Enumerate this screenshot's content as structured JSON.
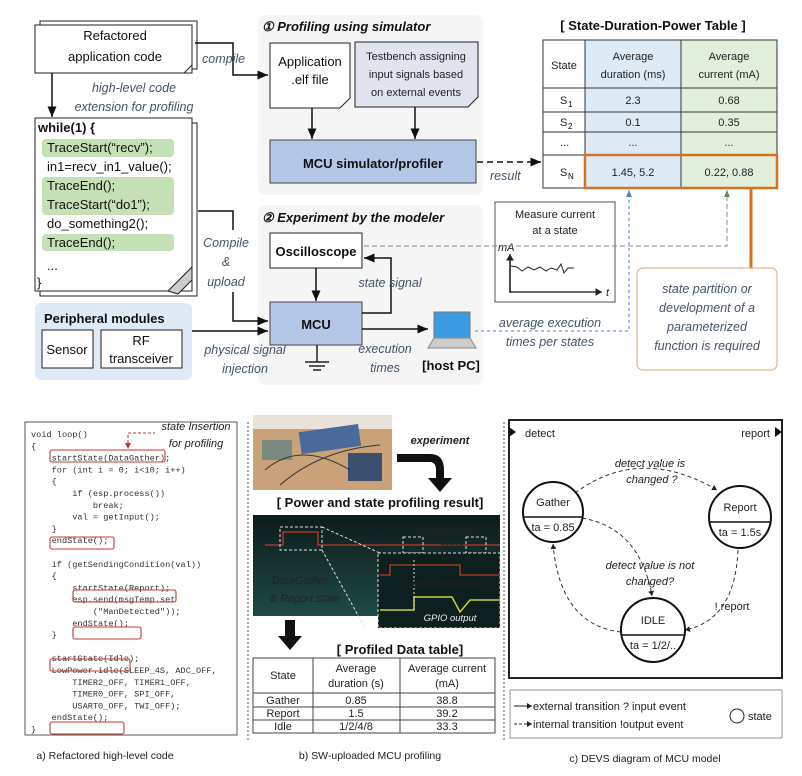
{
  "top": {
    "refactored_doc": [
      "Refactored",
      "application code"
    ],
    "compile_label": "compile",
    "extension_label": [
      "high-level code",
      "extension for profiling"
    ],
    "code_lines": [
      "while(1) {",
      "TraceStart(“recv”);",
      "in1=recv_in1_value();",
      "TraceEnd();",
      "TraceStart(“do1”);",
      "do_something2();",
      "TraceEnd();",
      "...",
      "}"
    ],
    "profiling": {
      "title": "① Profiling using simulator",
      "elf_file": [
        "Application",
        ".elf file"
      ],
      "testbench": [
        "Testbench assigning",
        "input signals based",
        "on external events"
      ],
      "simulator": "MCU simulator/profiler",
      "result_label": "result"
    },
    "experiment": {
      "title": "② Experiment by the modeler",
      "oscilloscope": "Oscilloscope",
      "mcu": "MCU",
      "state_signal": "state signal",
      "compile_upload": [
        "Compile",
        "&",
        "upload"
      ],
      "physical_signal": [
        "physical signal",
        "injection"
      ],
      "execution_times": [
        "execution",
        "times"
      ],
      "host_pc": "[host PC]"
    },
    "peripheral": {
      "title": "Peripheral modules",
      "sensor": "Sensor",
      "rf": [
        "RF",
        "transceiver"
      ]
    },
    "measure_box": {
      "title": [
        "Measure current",
        "at a state"
      ],
      "y_axis": "mA",
      "x_axis": "t"
    },
    "avg_exec_label": [
      "average execution",
      "times per states"
    ],
    "note": [
      "state partition or",
      "development of a",
      "parameterized",
      "function is required"
    ],
    "state_table": {
      "title": "[ State-Duration-Power Table ]",
      "headers": [
        "State",
        [
          "Average",
          "duration (ms)"
        ],
        [
          "Average",
          "current (mA)"
        ]
      ],
      "rows": [
        {
          "state": "S",
          "sub": "1",
          "duration": "2.3",
          "current": "0.68"
        },
        {
          "state": "S",
          "sub": "2",
          "duration": "0.1",
          "current": "0.35"
        },
        {
          "state": "...",
          "sub": "",
          "duration": "...",
          "current": "..."
        },
        {
          "state": "S",
          "sub": "N",
          "duration": "1.45, 5.2",
          "current": "0.22, 0.88"
        }
      ]
    }
  },
  "panel_a": {
    "annotation": [
      "state Insertion",
      "for profiling"
    ],
    "caption": "a) Refactored high-level code",
    "code": [
      "void loop()",
      "{",
      "    startState(DataGather);",
      "    for (int i = 0; i<10; i++)",
      "    {",
      "        if (esp.process())",
      "            break;",
      "        val = getInput();",
      "    }",
      "    endState();",
      "",
      "    if (getSendingCondition(val))",
      "    {",
      "        startState(Report);",
      "        esp.send(msgTemp.set",
      "            (\"ManDetected\"));",
      "        endState();",
      "    }",
      "",
      "    startState(Idle);",
      "    LowPower.idle(SLEEP_4S, ADC_OFF,",
      "        TIMER2_OFF, TIMER1_OFF,",
      "        TIMER0_OFF, SPI_OFF,",
      "        USART0_OFF, TWI_OFF);",
      "    endState();",
      "}"
    ]
  },
  "panel_b": {
    "experiment_label": "experiment",
    "scope_title": "[ Power and state profiling result]",
    "scope_labels": {
      "datagather_state": [
        "DataGather",
        "state"
      ],
      "datagather_report": [
        "DataGather",
        "& Report state"
      ],
      "state_separation": "State separation",
      "gpio_output": "GPIO output"
    },
    "table_title": "[ Profiled Data table]",
    "table": {
      "headers": [
        "State",
        [
          "Average",
          "duration (s)"
        ],
        [
          "Average current",
          "(mA)"
        ]
      ],
      "rows": [
        [
          "Gather",
          "0.85",
          "38.8"
        ],
        [
          "Report",
          "1.5",
          "39.2"
        ],
        [
          "Idle",
          "1/2/4/8",
          "33.3"
        ]
      ]
    },
    "caption": "b) SW-uploaded MCU profiling"
  },
  "panel_c": {
    "input_port": "detect",
    "output_port": "report",
    "states": [
      {
        "name": "Gather",
        "ta": "ta = 0.85"
      },
      {
        "name": "Report",
        "ta": "ta = 1.5s"
      },
      {
        "name": "IDLE",
        "ta": "ta = 1/2/.."
      }
    ],
    "transitions": {
      "changed": [
        "detect value is",
        "changed ?"
      ],
      "not_changed": [
        "detect value is not",
        "changed?"
      ],
      "report_out": "! report"
    },
    "legend": {
      "external": "external transition ? input event",
      "internal": "internal transition  !output event",
      "state": "state"
    },
    "caption": "c) DEVS diagram of MCU model"
  },
  "colors": {
    "sim_blue": "#b4c7e7",
    "code_green": "#c5e0b4",
    "orange": "#d6711f",
    "duration_col": "#ddebf7",
    "current_col": "#e2efda",
    "panel_grey": "#f5f5f5",
    "peripheral_bg": "#deebf7"
  }
}
